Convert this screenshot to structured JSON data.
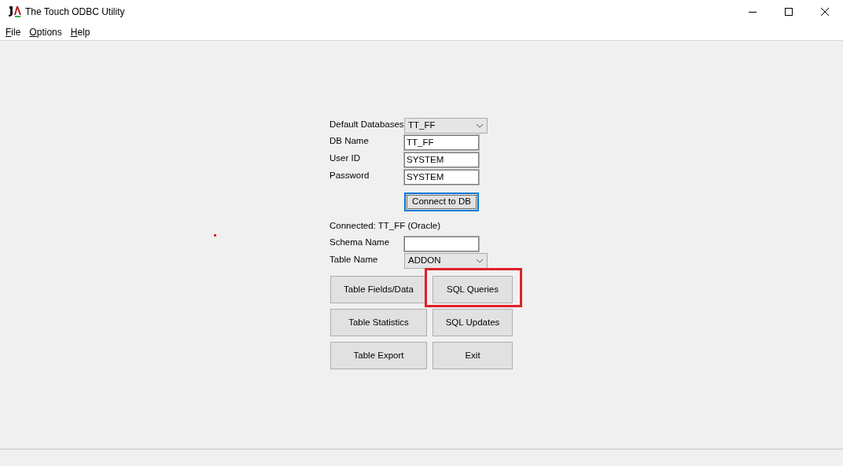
{
  "window": {
    "title": "The Touch ODBC Utility"
  },
  "menu": [
    {
      "label": "File"
    },
    {
      "label": "Options"
    },
    {
      "label": "Help"
    }
  ],
  "login": [
    {
      "kind": "combo",
      "label": "Default Databases",
      "value": "TT_FF"
    },
    {
      "kind": "text",
      "label": "DB Name",
      "value": "TT_FF"
    },
    {
      "kind": "text",
      "label": "User ID",
      "value": "SYSTEM"
    },
    {
      "kind": "text",
      "label": "Password",
      "value": "SYSTEM"
    }
  ],
  "connect_button": {
    "label": "Connect to DB",
    "focused": true
  },
  "status": "Connected: TT_FF (Oracle)",
  "table_fields": [
    {
      "kind": "text",
      "label": "Schema Name"
    },
    {
      "kind": "combo",
      "label": "Table Name",
      "value": "ADDON"
    }
  ],
  "buttons": [
    {
      "label": "Table Fields/Data",
      "highlighted": false
    },
    {
      "label": "SQL Queries",
      "highlighted": true
    },
    {
      "label": "Table Statistics",
      "highlighted": false
    },
    {
      "label": "SQL Updates",
      "highlighted": false
    },
    {
      "label": "Table Export",
      "highlighted": false
    },
    {
      "label": "Exit",
      "highlighted": false
    }
  ]
}
